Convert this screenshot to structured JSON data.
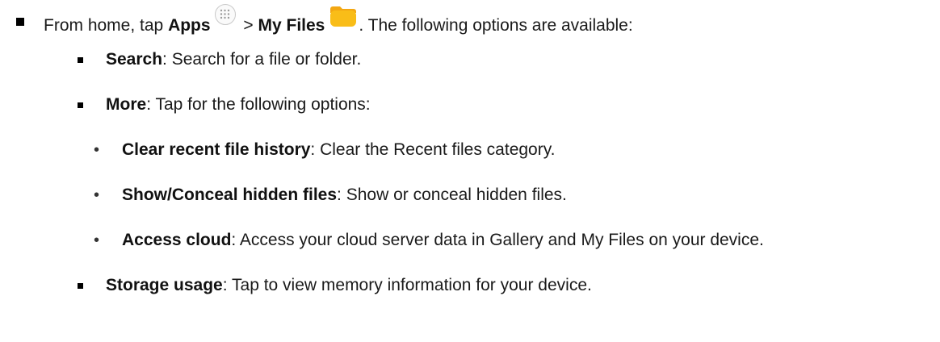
{
  "intro": {
    "prefix": "From home, tap ",
    "apps_label": "Apps",
    "separator": " > ",
    "myfiles_label": "My Files",
    "suffix": ". The following options are available:",
    "apps_icon": "apps-grid-icon",
    "myfiles_icon": "yellow-folder-icon"
  },
  "options": [
    {
      "term": "Search",
      "desc": ": Search for a file or folder."
    },
    {
      "term": "More",
      "desc": ": Tap for the following options:"
    },
    {
      "term": "Storage usage",
      "desc": ": Tap to view memory information for your device."
    }
  ],
  "more_options": [
    {
      "term": "Clear recent file history",
      "desc": ": Clear the Recent files category."
    },
    {
      "term": "Show/Conceal hidden files",
      "desc": ": Show or conceal hidden files."
    },
    {
      "term": "Access cloud",
      "desc": ": Access your cloud server data in Gallery and My Files on your device."
    }
  ],
  "bullets": {
    "dot": "•"
  },
  "colors": {
    "folder_body": "#f9bd18",
    "folder_tab": "#f3a712",
    "apps_ring": "#c9c9c9",
    "text": "#1a1a1a"
  }
}
